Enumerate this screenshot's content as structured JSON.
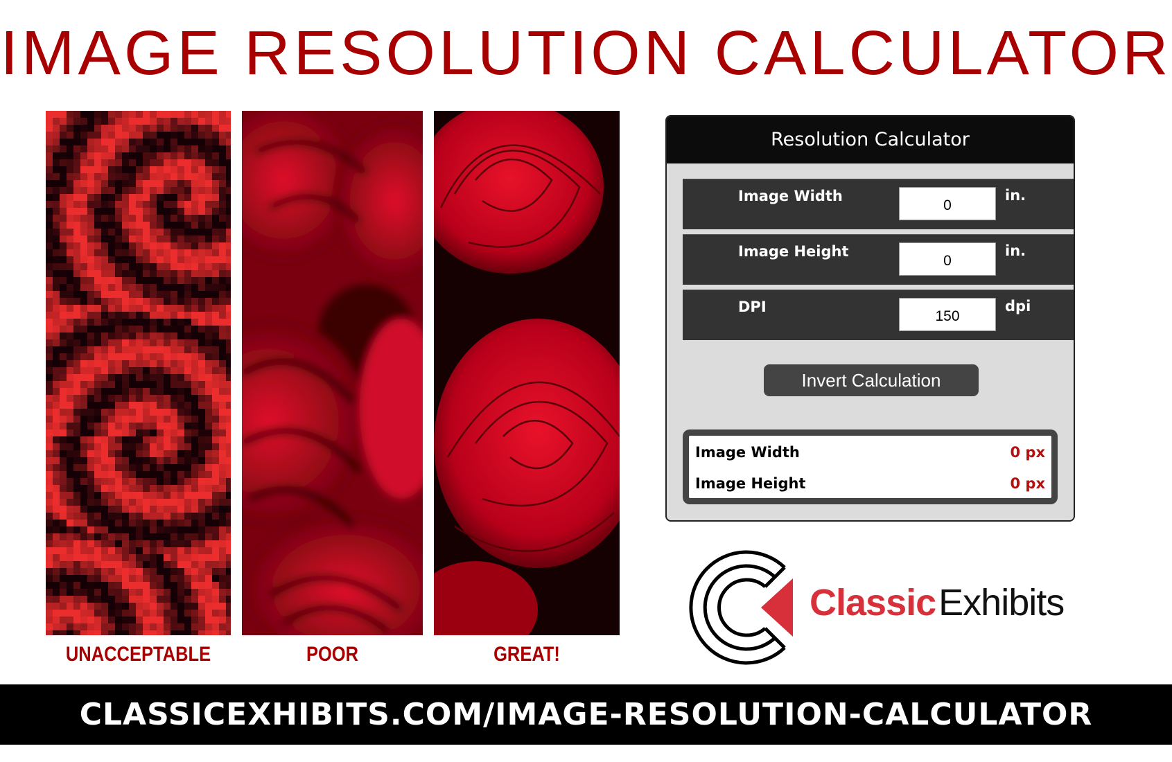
{
  "title": "IMAGE RESOLUTION CALCULATOR",
  "examples": [
    {
      "label": "UNACCEPTABLE",
      "quality": "pixelated"
    },
    {
      "label": "POOR",
      "quality": "blurry"
    },
    {
      "label": "GREAT!",
      "quality": "sharp"
    }
  ],
  "calculator": {
    "header": "Resolution Calculator",
    "fields": [
      {
        "label": "Image Width",
        "value": "0",
        "unit": "in."
      },
      {
        "label": "Image Height",
        "value": "0",
        "unit": "in."
      },
      {
        "label": "DPI",
        "value": "150",
        "unit": "dpi"
      }
    ],
    "invert_button": "Invert Calculation",
    "results": [
      {
        "label": "Image Width",
        "value": "0 px"
      },
      {
        "label": "Image Height",
        "value": "0 px"
      }
    ]
  },
  "logo": {
    "word1": "Classic",
    "word2": "Exhibits"
  },
  "footer": {
    "url": "CLASSICEXHIBITS.COM/IMAGE-RESOLUTION-CALCULATOR"
  },
  "colors": {
    "title_red": "#a80000",
    "logo_red": "#d8303a",
    "result_red": "#b31010",
    "panel_dark": "#333333",
    "header_black": "#0c0c0c"
  }
}
